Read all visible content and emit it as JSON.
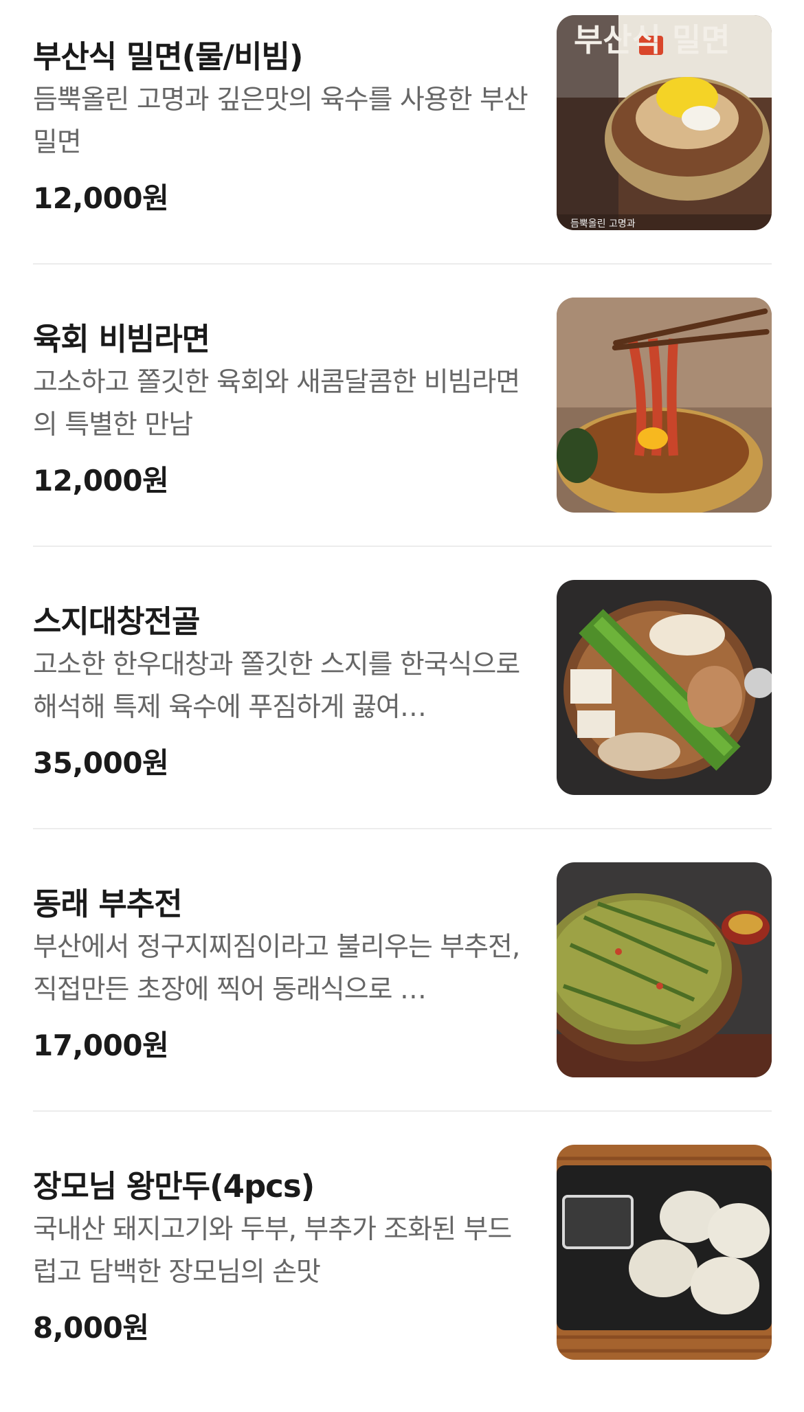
{
  "menu": {
    "items": [
      {
        "name": "부산식 밀면(물/비빔)",
        "description": "듬뿍올린 고명과 깊은맛의 육수를 사용한 부산 밀면",
        "price": "12,000원",
        "image_caption": "부산식 밀면",
        "image_subcaption": "듬뿍올린 고명과"
      },
      {
        "name": "육회 비빔라면",
        "description": "고소하고 쫄깃한 육회와 새콤달콤한 비빔라면의 특별한 만남",
        "price": "12,000원"
      },
      {
        "name": "스지대창전골",
        "description": "고소한 한우대창과 쫄깃한 스지를 한국식으로 해석해 특제 육수에 푸짐하게 끓여…",
        "price": "35,000원"
      },
      {
        "name": "동래 부추전",
        "description": "부산에서 정구지찌짐이라고 불리우는 부추전, 직접만든 초장에 찍어 동래식으로 …",
        "price": "17,000원"
      },
      {
        "name": "장모님 왕만두(4pcs)",
        "description": "국내산 돼지고기와 두부, 부추가 조화된 부드럽고 담백한 장모님의 손맛",
        "price": "8,000원"
      }
    ]
  }
}
